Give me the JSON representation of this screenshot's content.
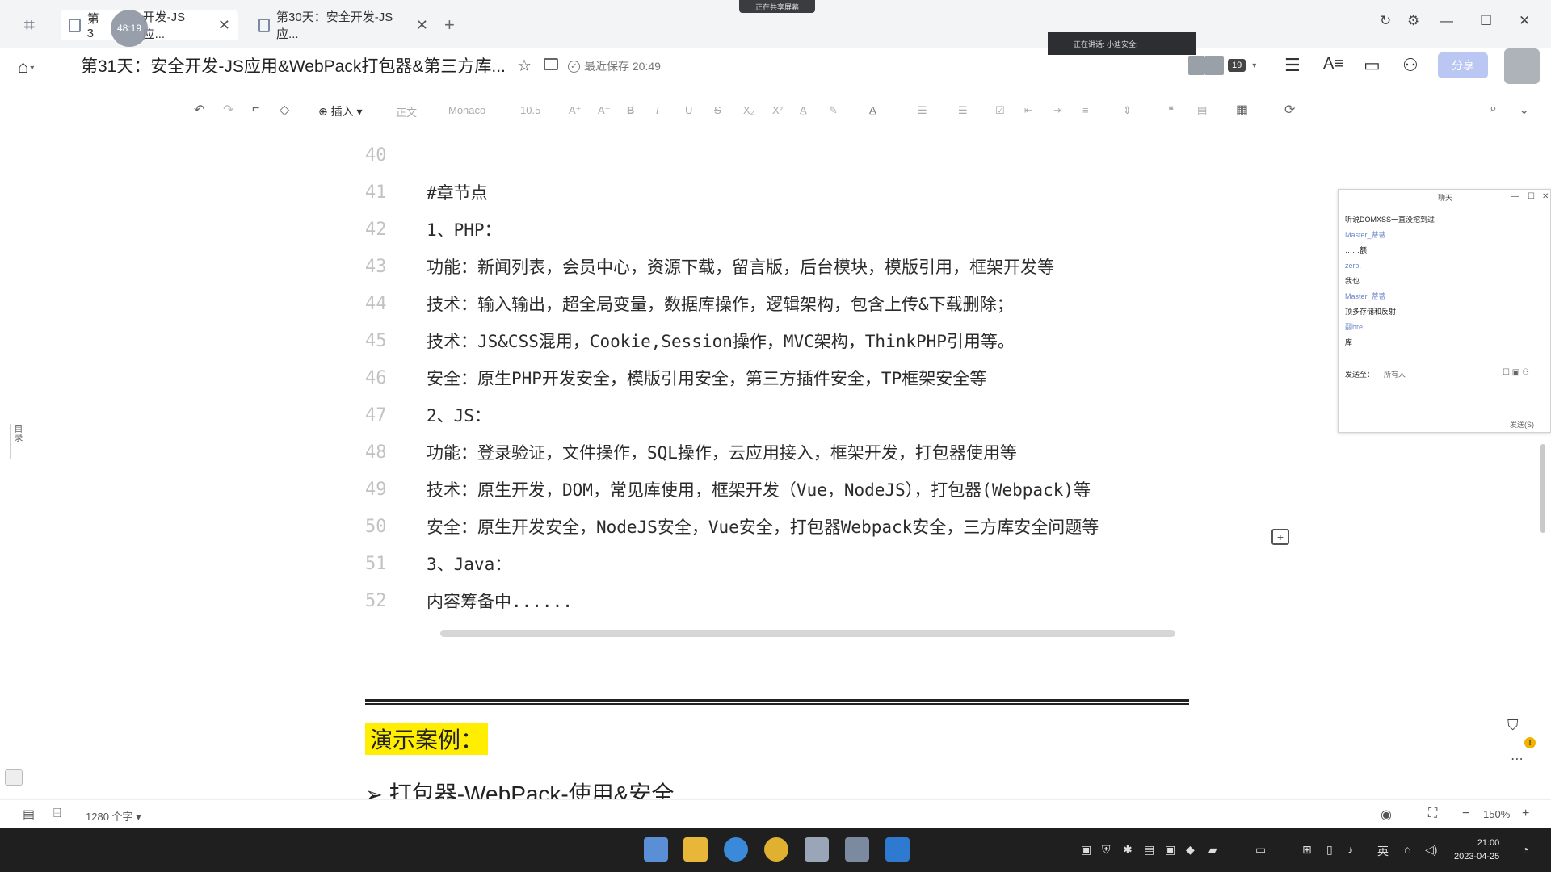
{
  "tabs": [
    {
      "label": "第3",
      "label_rest": "开发-JS应...",
      "active": true
    },
    {
      "label": "第30天：安全开发-JS应...",
      "active": false
    }
  ],
  "timer_badge": "48:19",
  "share_banner": "正在共享屏幕",
  "doc": {
    "title": "第31天：安全开发-JS应用&WebPack打包器&第三方库...",
    "save_status": "最近保存 20:49"
  },
  "speaker_notice": "正在讲话: 小迪安全;",
  "collaborators": {
    "count": "19"
  },
  "share_button": "分享",
  "toolbar": {
    "insert": "插入",
    "style": "正文",
    "font": "Monaco",
    "size": "10.5"
  },
  "code_lines": [
    {
      "num": "40",
      "text": ""
    },
    {
      "num": "41",
      "text": "#章节点"
    },
    {
      "num": "42",
      "text": "1、PHP："
    },
    {
      "num": "43",
      "text": "功能：新闻列表，会员中心，资源下载，留言版，后台模块，模版引用，框架开发等"
    },
    {
      "num": "44",
      "text": "技术：输入输出，超全局变量，数据库操作，逻辑架构，包含上传&下载删除；"
    },
    {
      "num": "45",
      "text": "技术：JS&CSS混用，Cookie,Session操作，MVC架构，ThinkPHP引用等。"
    },
    {
      "num": "46",
      "text": "安全：原生PHP开发安全，模版引用安全，第三方插件安全，TP框架安全等"
    },
    {
      "num": "47",
      "text": "2、JS："
    },
    {
      "num": "48",
      "text": "功能：登录验证，文件操作，SQL操作，云应用接入，框架开发，打包器使用等"
    },
    {
      "num": "49",
      "text": "技术：原生开发，DOM，常见库使用，框架开发（Vue，NodeJS），打包器(Webpack)等"
    },
    {
      "num": "50",
      "text": "安全：原生开发安全，NodeJS安全，Vue安全，打包器Webpack安全，三方库安全问题等"
    },
    {
      "num": "51",
      "text": "3、Java："
    },
    {
      "num": "52",
      "text": "内容筹备中......"
    }
  ],
  "demo_heading": "演示案例：",
  "section_heading": "打包器-WebPack-使用&安全",
  "outline_label": "目录",
  "chat": {
    "title": "聊天",
    "messages": [
      {
        "kind": "text",
        "text": "听说DOMXSS一直没挖到过"
      },
      {
        "kind": "user",
        "text": "Master_蒂蒂"
      },
      {
        "kind": "text",
        "text": "……额"
      },
      {
        "kind": "user",
        "text": "zero."
      },
      {
        "kind": "text",
        "text": "我也"
      },
      {
        "kind": "user",
        "text": "Master_蒂蒂"
      },
      {
        "kind": "text",
        "text": "顶多存储和反射"
      },
      {
        "kind": "user",
        "text": "翻hre."
      },
      {
        "kind": "text",
        "text": "库"
      }
    ],
    "send_to_label": "发送至：",
    "send_to_value": "所有人",
    "send_button": "发送(S)"
  },
  "statusbar": {
    "word_count": "1280 个字",
    "zoom": "150%"
  },
  "clock": {
    "time": "21:00",
    "date": "2023-04-25"
  },
  "ime": "英",
  "colors": {
    "highlight": "#ffee00",
    "share_button": "#b9c7f2",
    "taskbar": "#1f1f1f",
    "line_numbers": "#c2c2c2"
  }
}
